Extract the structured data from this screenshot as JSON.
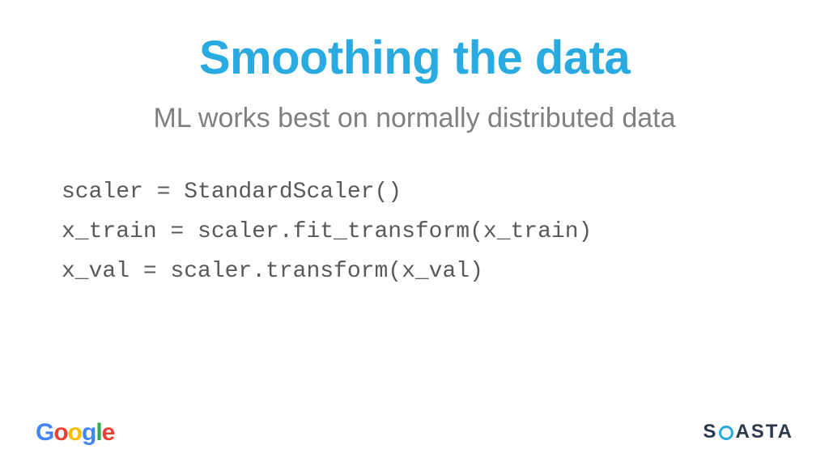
{
  "slide": {
    "title": "Smoothing the data",
    "subtitle": "ML works best on normally distributed data",
    "code": {
      "line1": "scaler = StandardScaler()",
      "line2": "x_train = scaler.fit_transform(x_train)",
      "line3": "x_val = scaler.transform(x_val)"
    }
  },
  "footer": {
    "google": {
      "g1": "G",
      "o1": "o",
      "o2": "o",
      "g2": "g",
      "l1": "l",
      "e1": "e"
    },
    "soasta": {
      "s1": "S",
      "s2": "ASTA"
    }
  }
}
